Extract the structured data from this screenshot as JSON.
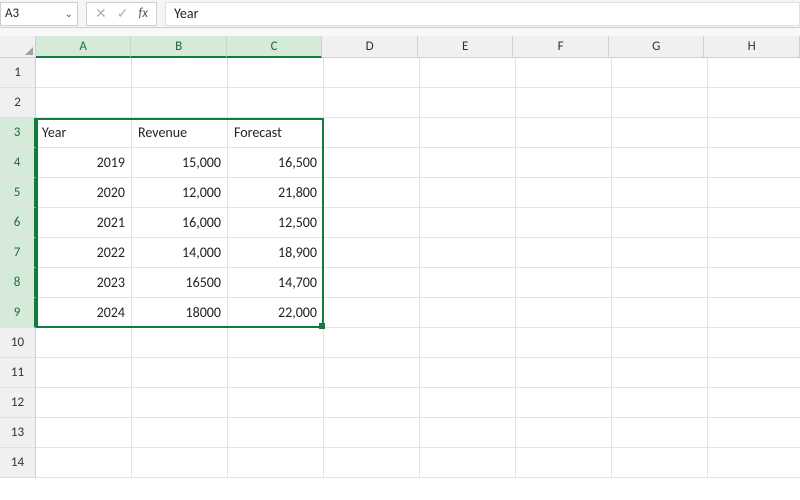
{
  "nameBox": {
    "value": "A3"
  },
  "formulaBar": {
    "value": "Year"
  },
  "fxLabel": "fx",
  "cancelGlyph": "✕",
  "acceptGlyph": "✓",
  "columns": [
    "A",
    "B",
    "C",
    "D",
    "E",
    "F",
    "G",
    "H"
  ],
  "selectedCols": [
    "A",
    "B",
    "C"
  ],
  "rows": [
    "1",
    "2",
    "3",
    "4",
    "5",
    "6",
    "7",
    "8",
    "9",
    "10",
    "11",
    "12",
    "13",
    "14"
  ],
  "selectedRows": [
    "3",
    "4",
    "5",
    "6",
    "7",
    "8",
    "9"
  ],
  "cells": {
    "r3": {
      "A": {
        "v": "Year",
        "align": "left"
      },
      "B": {
        "v": "Revenue",
        "align": "left"
      },
      "C": {
        "v": "Forecast",
        "align": "left"
      }
    },
    "r4": {
      "A": {
        "v": "2019",
        "align": "right"
      },
      "B": {
        "v": "15,000",
        "align": "right"
      },
      "C": {
        "v": "16,500",
        "align": "right"
      }
    },
    "r5": {
      "A": {
        "v": "2020",
        "align": "right"
      },
      "B": {
        "v": "12,000",
        "align": "right"
      },
      "C": {
        "v": "21,800",
        "align": "right"
      }
    },
    "r6": {
      "A": {
        "v": "2021",
        "align": "right"
      },
      "B": {
        "v": "16,000",
        "align": "right"
      },
      "C": {
        "v": "12,500",
        "align": "right"
      }
    },
    "r7": {
      "A": {
        "v": "2022",
        "align": "right"
      },
      "B": {
        "v": "14,000",
        "align": "right"
      },
      "C": {
        "v": "18,900",
        "align": "right"
      }
    },
    "r8": {
      "A": {
        "v": "2023",
        "align": "right"
      },
      "B": {
        "v": "16500",
        "align": "right"
      },
      "C": {
        "v": "14,700",
        "align": "right"
      }
    },
    "r9": {
      "A": {
        "v": "2024",
        "align": "right"
      },
      "B": {
        "v": "18000",
        "align": "right"
      },
      "C": {
        "v": "22,000",
        "align": "right"
      }
    }
  }
}
